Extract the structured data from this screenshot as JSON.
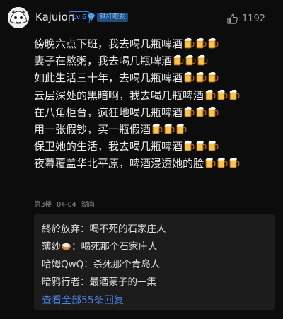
{
  "post": {
    "author": "Kajuion",
    "level": "Lv.6",
    "fan_badge": "铁杆吧友",
    "likes": "1192",
    "lines": [
      {
        "text": "傍晚六点下班，我去喝几瓶啤酒",
        "beers": 3
      },
      {
        "text": "妻子在熬粥，我去喝几瓶啤酒",
        "beers": 3
      },
      {
        "text": "如此生活三十年，去喝几瓶啤酒",
        "beers": 3
      },
      {
        "text": "云层深处的黑暗啊，我去喝几瓶啤酒",
        "beers": 3
      },
      {
        "text": "在八角柜台，疯狂地喝几瓶啤酒",
        "beers": 3
      },
      {
        "text": "用一张假钞，买一瓶假酒",
        "beers": 3
      },
      {
        "text": "保卫她的生活，我去喝几瓶啤酒",
        "beers": 3
      },
      {
        "text": "夜幕覆盖华北平原，啤酒浸透她的脸",
        "beers": 3
      }
    ],
    "floor": "第3楼",
    "date": "04-04",
    "location": "湖南"
  },
  "replies": {
    "items": [
      {
        "name": "終於放弃",
        "text": "：喝不死的石家庄人",
        "emoji": ""
      },
      {
        "name": "薄纱",
        "text": "：喝死那个石家庄人",
        "emoji": "rice-bowl"
      },
      {
        "name": "哈姆QwQ",
        "text": "：杀死那个青岛人",
        "emoji": ""
      },
      {
        "name": "暗鸦行者",
        "text": "：最酒蒙子的一集",
        "emoji": ""
      }
    ],
    "view_all": "查看全部55条回复"
  },
  "colors": {
    "background": "#0c0c0c",
    "reply_panel": "#1c1c1c",
    "link": "#4a86ea",
    "level": "#5c9bff",
    "beer": "#f2b233"
  },
  "icons": {
    "like": "thumbs-up-icon",
    "avatar": "cartoon-avatar",
    "badge": "diamond-gem-icon"
  }
}
